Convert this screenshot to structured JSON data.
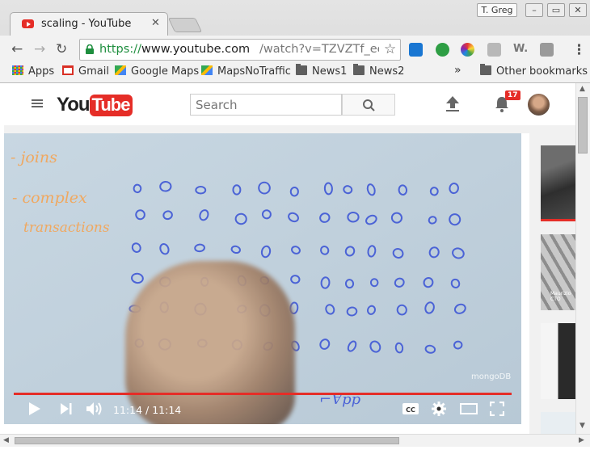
{
  "window": {
    "tab_title": "scaling - YouTube",
    "tab_close": "✕",
    "user": "T. Greg",
    "minimize": "–",
    "maximize": "▭",
    "close": "✕"
  },
  "toolbar": {
    "url_scheme": "https://",
    "url_host": "www.youtube.com",
    "url_path": "/watch?v=TZVZTf_eeaM&feature=youtu.be",
    "back": "←",
    "forward": "→",
    "reload": "↻",
    "star": "☆",
    "menu": "⋮"
  },
  "bookmarks": {
    "items": [
      {
        "label": "Apps",
        "icon": "apps-grid-icon"
      },
      {
        "label": "Gmail",
        "icon": "gmail-icon"
      },
      {
        "label": "Google Maps",
        "icon": "maps-icon"
      },
      {
        "label": "MapsNoTraffic",
        "icon": "maps-icon"
      },
      {
        "label": "News1",
        "icon": "folder-icon"
      },
      {
        "label": "News2",
        "icon": "folder-icon"
      }
    ],
    "overflow": "»",
    "other": "Other bookmarks"
  },
  "youtube": {
    "search_placeholder": "Search",
    "notification_count": "17",
    "logo_you": "You",
    "logo_tube": "Tube"
  },
  "video": {
    "notes": [
      "- joins",
      "- complex",
      "transactions"
    ],
    "watermark": "mongoDB",
    "current_time": "11:14",
    "separator": " / ",
    "duration": "11:14",
    "progress": 1.0,
    "cc_label": "CC"
  },
  "sidebar": {
    "thumb_caption": "Maurizio\nCTO"
  },
  "colors": {
    "youtube_red": "#e52d27",
    "url_green": "#1e8e3e",
    "marker_blue": "#4b63d6",
    "marker_orange": "#f0a860"
  }
}
